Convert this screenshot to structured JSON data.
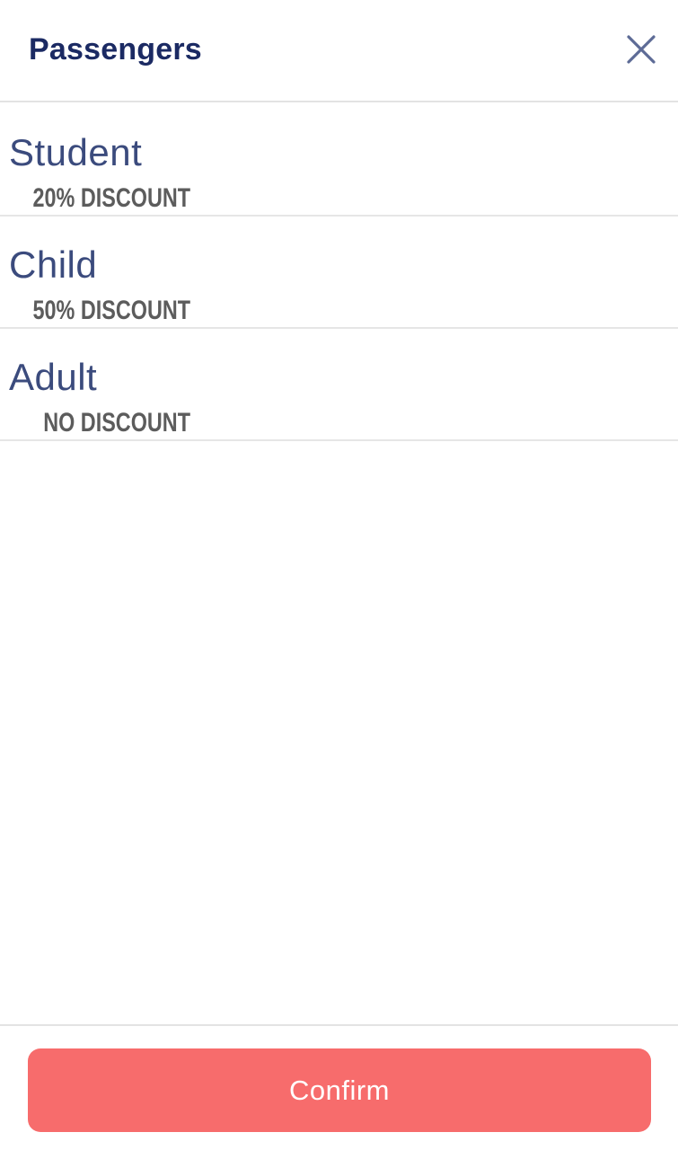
{
  "header": {
    "title": "Passengers",
    "close_icon": "close-icon"
  },
  "passengers": [
    {
      "label": "Student",
      "discount": "20% DISCOUNT"
    },
    {
      "label": "Child",
      "discount": "50% DISCOUNT"
    },
    {
      "label": "Adult",
      "discount": "NO DISCOUNT"
    }
  ],
  "footer": {
    "confirm_label": "Confirm"
  },
  "colors": {
    "title": "#1b2a63",
    "option_label": "#3b4b7d",
    "discount_text": "#5c5c5c",
    "confirm_button": "#f76c6c",
    "divider": "#e3e3e3"
  }
}
